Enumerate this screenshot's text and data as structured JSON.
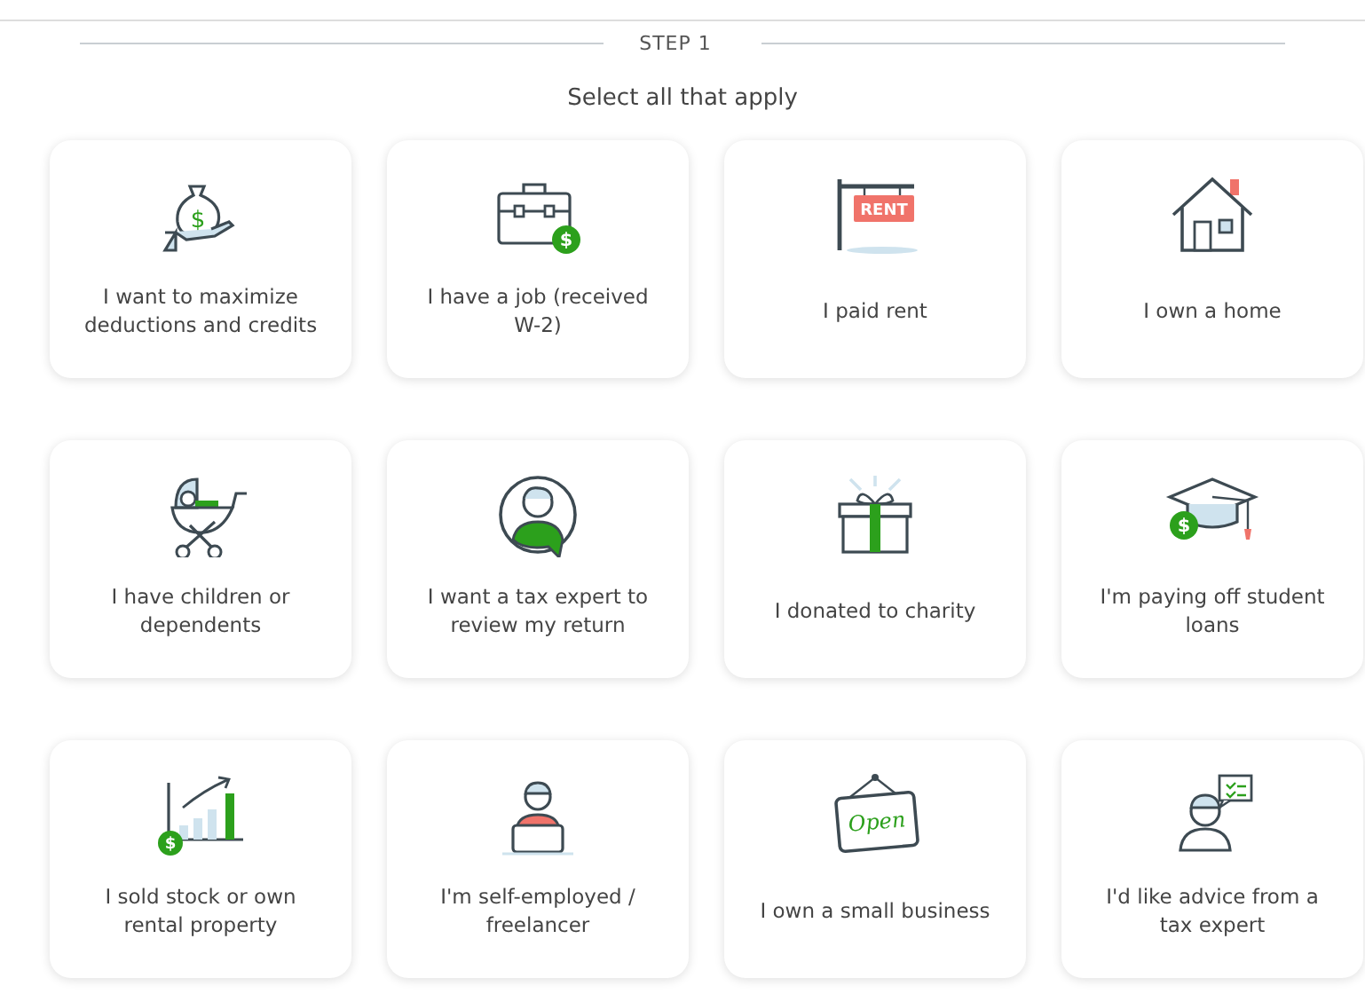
{
  "step": {
    "label": "STEP 1"
  },
  "instruction": "Select all that apply",
  "cards": [
    {
      "label": "I want to maximize deductions and credits",
      "selected": false,
      "icon_text": "$"
    },
    {
      "label": "I have a job (received W-2)",
      "selected": false,
      "icon_text": "$"
    },
    {
      "label": "I paid rent",
      "selected": false,
      "icon_text": "RENT"
    },
    {
      "label": "I own a home",
      "selected": false
    },
    {
      "label": "I have children or dependents",
      "selected": false
    },
    {
      "label": "I want a tax expert to review my return",
      "selected": false
    },
    {
      "label": "I donated to charity",
      "selected": false
    },
    {
      "label": "I'm paying off student loans",
      "selected": false,
      "icon_text": "$"
    },
    {
      "label": "I sold stock or own rental property",
      "selected": false,
      "icon_text": "$"
    },
    {
      "label": "I'm self-employed / freelancer",
      "selected": false
    },
    {
      "label": "I own a small business",
      "selected": false,
      "icon_text": "Open"
    },
    {
      "label": "I'd like advice from a tax expert",
      "selected": false
    }
  ]
}
